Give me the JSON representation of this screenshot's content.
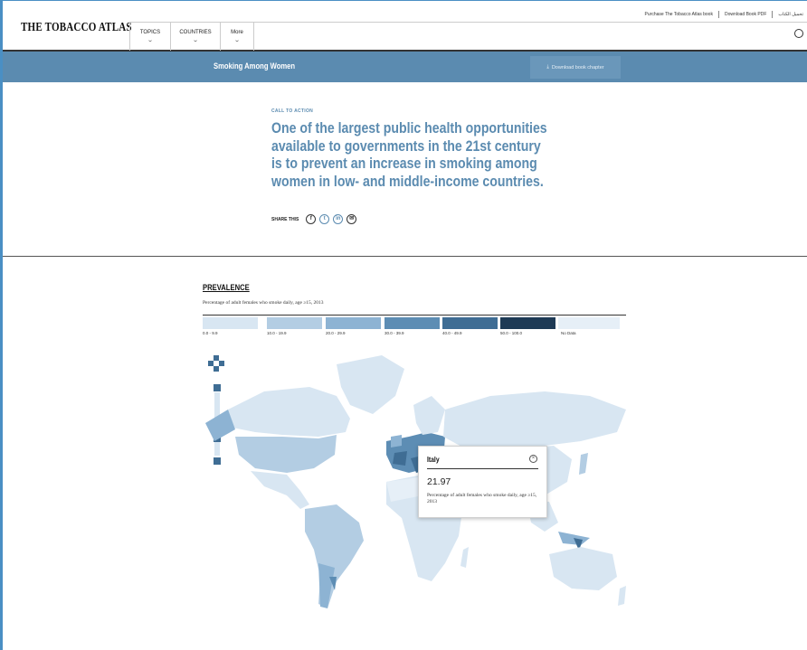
{
  "header": {
    "logo": "THE TOBACCO ATLAS",
    "top_links": [
      "Purchase The Tobacco Atlas book",
      "Download Book PDF",
      "تحميل الكتاب"
    ],
    "nav": [
      {
        "label": "TOPICS"
      },
      {
        "label": "COUNTRIES"
      },
      {
        "label": "More"
      }
    ]
  },
  "bar": {
    "title": "Smoking Among Women",
    "download_label": "Download book chapter"
  },
  "cta": {
    "label": "CALL TO ACTION",
    "quote": "One of the largest public health opportunities available to governments in the 21st century is to prevent an increase in smoking among women in low- and middle-income countries.",
    "share_label": "SHARE THIS"
  },
  "prevalence": {
    "title": "PREVALENCE",
    "subtitle": "Percentage of adult females who smoke daily, age ≥15, 2013",
    "legend": [
      {
        "label": "0.0 - 9.9",
        "color": "#d8e6f2"
      },
      {
        "label": "10.0 - 19.9",
        "color": "#b3cde3"
      },
      {
        "label": "20.0 - 29.9",
        "color": "#8db3d3"
      },
      {
        "label": "30.0 - 39.9",
        "color": "#5d8db4"
      },
      {
        "label": "40.0 - 49.9",
        "color": "#3f6d94"
      },
      {
        "label": "50.0 - 100.0",
        "color": "#1e3a55"
      },
      {
        "label": "No Data",
        "color": "#e6eff7"
      }
    ]
  },
  "tooltip": {
    "country": "Italy",
    "value": "21.97",
    "description": "Percentage of adult females who smoke daily, age ≥15, 2013"
  },
  "colors": {
    "accent": "#5b8bb0",
    "land_light": "#d8e6f2",
    "land_mid": "#b3cde3",
    "land_dark": "#3f6d94"
  }
}
